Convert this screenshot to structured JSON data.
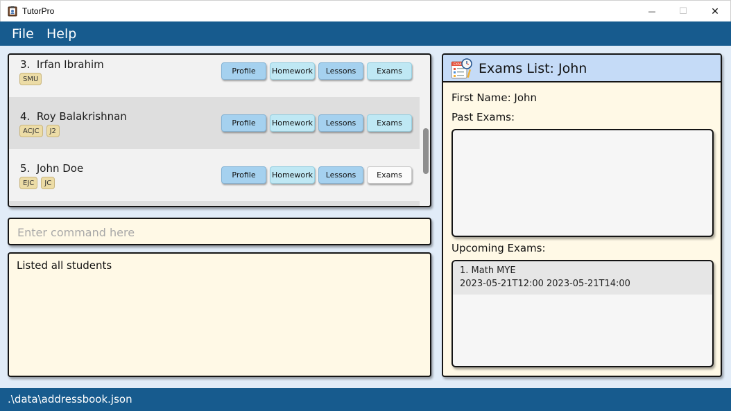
{
  "window": {
    "title": "TutorPro",
    "icons": {
      "app": "clipboard-icon",
      "minimize": "minimize-icon",
      "maximize": "maximize-icon",
      "close": "close-icon"
    },
    "controls": {
      "minimize": "—",
      "maximize": "☐",
      "close": "✕"
    }
  },
  "menu": {
    "file": "File",
    "help": "Help"
  },
  "students": [
    {
      "name": "3.  Irfan Ibrahim",
      "tags": [
        "SMU"
      ]
    },
    {
      "name": "4.  Roy Balakrishnan",
      "tags": [
        "ACJC",
        "J2"
      ]
    },
    {
      "name": "5.  John Doe",
      "tags": [
        "EJC",
        "JC"
      ]
    }
  ],
  "student_buttons": {
    "profile": "Profile",
    "homework": "Homework",
    "lessons": "Lessons",
    "exams": "Exams"
  },
  "command": {
    "placeholder": "Enter command here",
    "value": ""
  },
  "result": {
    "text": "Listed all students"
  },
  "exams_panel": {
    "icon": "exam-calendar-icon",
    "title": "Exams List: John",
    "first_name": "First Name: John",
    "past_label": "Past Exams:",
    "upcoming_label": "Upcoming Exams:",
    "upcoming": [
      {
        "name": "1. Math MYE",
        "start": "2023-05-21T12:00",
        "end": "2023-05-21T14:00"
      }
    ]
  },
  "status": {
    "path": ".\\data\\addressbook.json"
  },
  "colors": {
    "accent": "#175b8e",
    "panel_bg": "#fff9e6",
    "main_bg": "#e1ecf8",
    "tag_bg": "#ecdca6",
    "header_bg": "#c5dbf7"
  }
}
